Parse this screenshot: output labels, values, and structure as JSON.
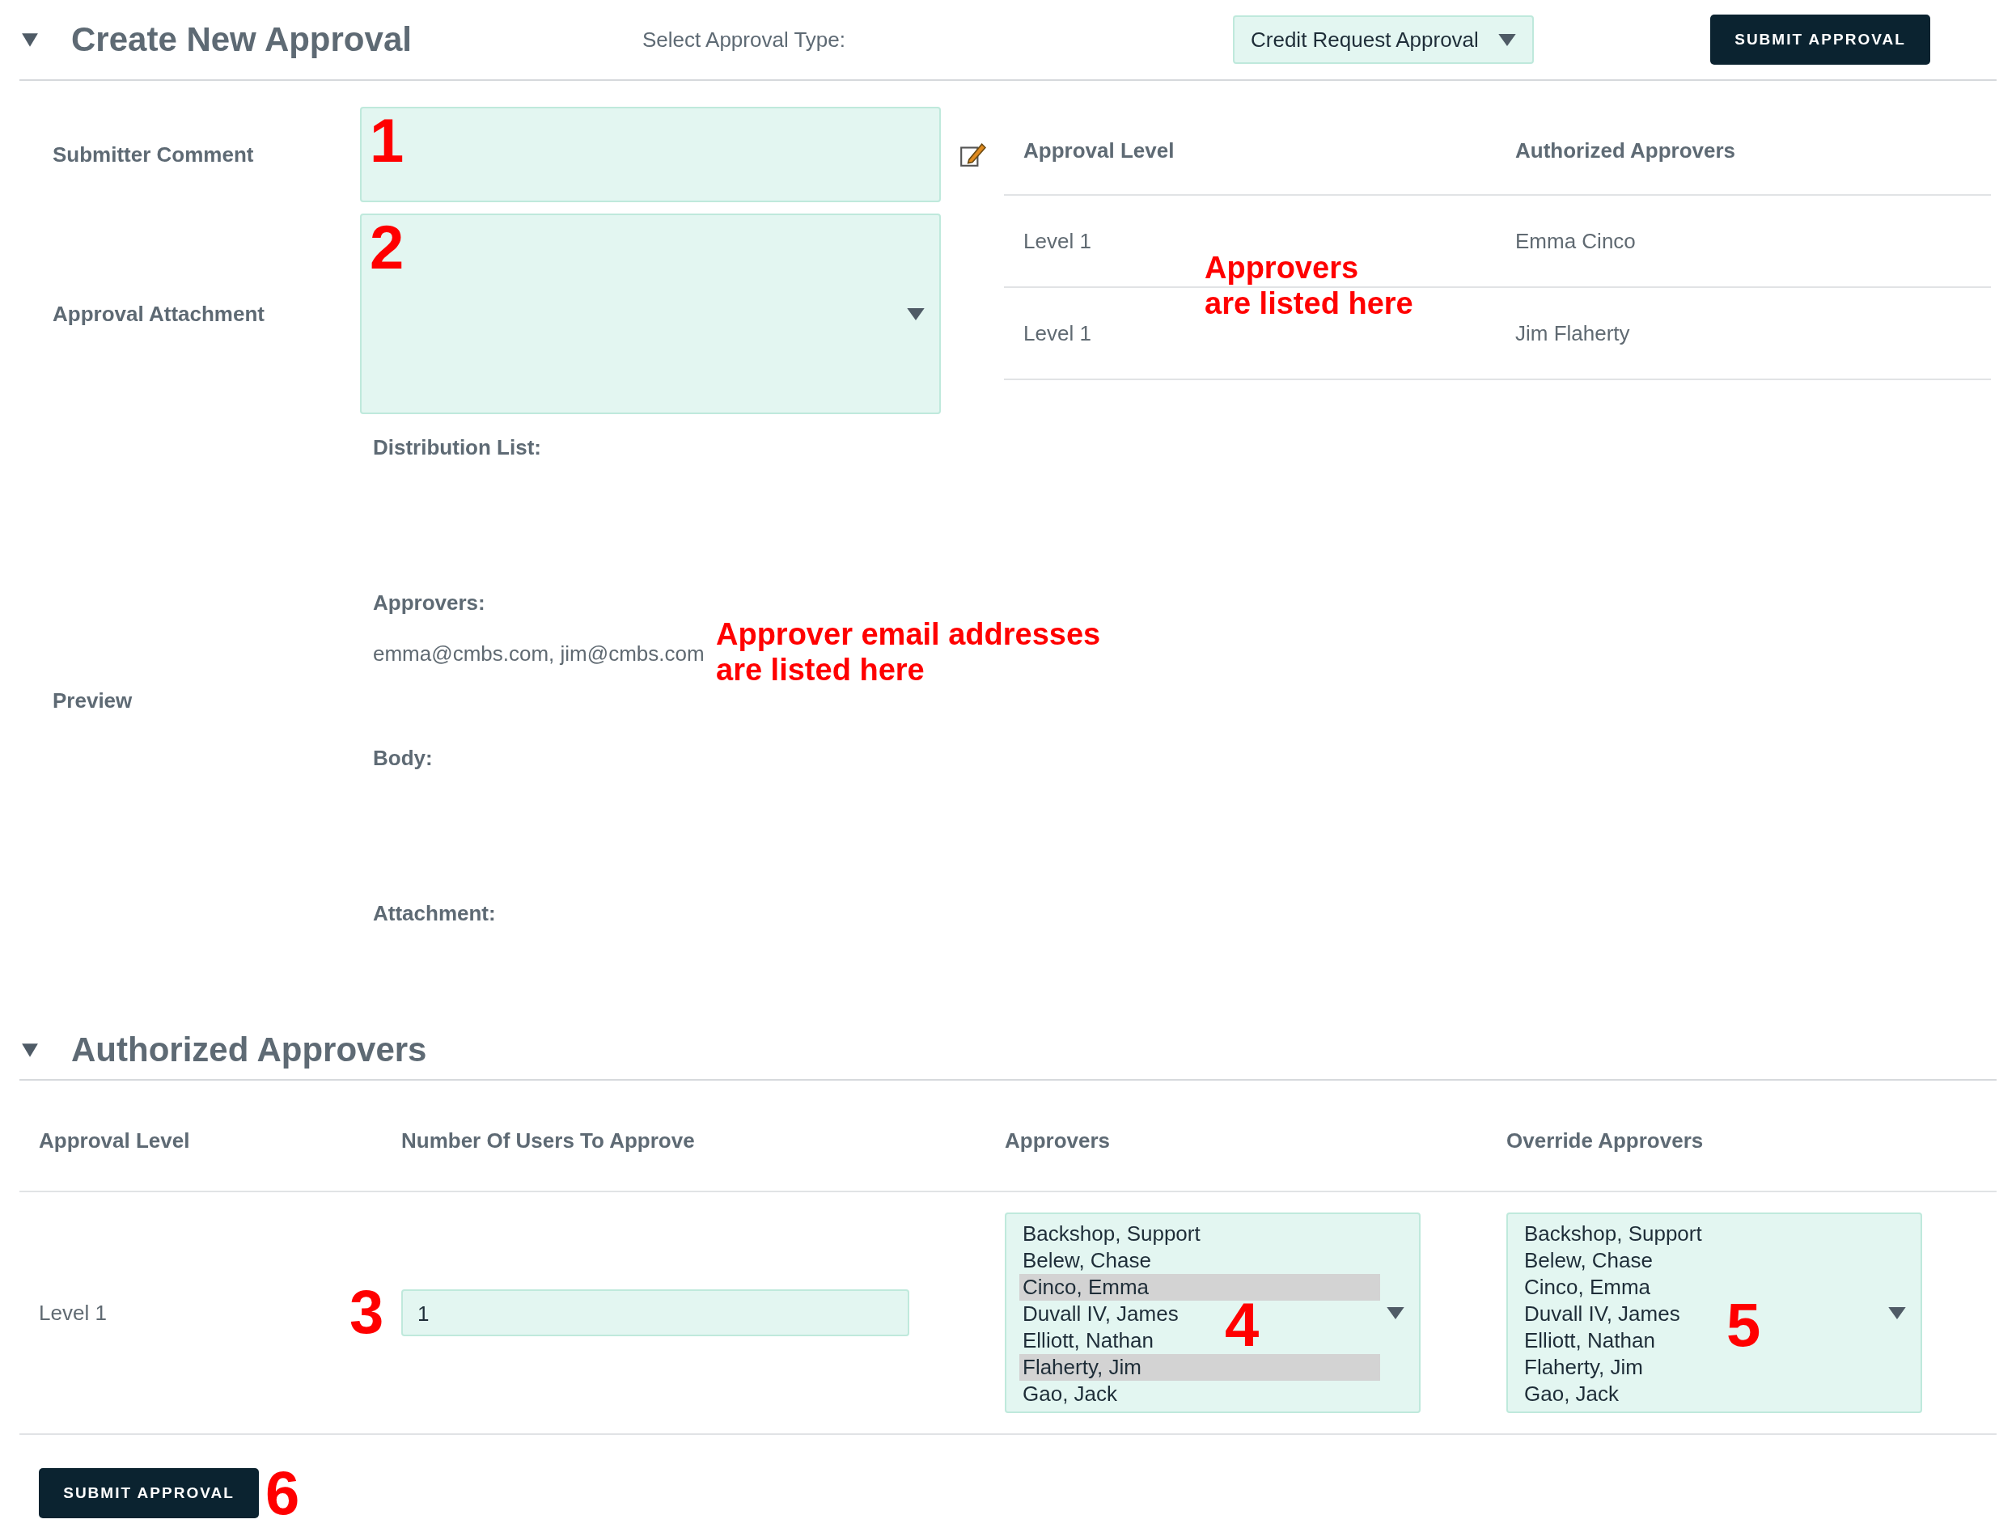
{
  "header": {
    "title": "Create New Approval",
    "expanded": true,
    "type_label": "Select Approval Type:",
    "type_value": "Credit Request Approval",
    "submit": "SUBMIT APPROVAL"
  },
  "form": {
    "comment": {
      "label": "Submitter Comment",
      "marker": "1"
    },
    "attachment": {
      "label": "Approval Attachment",
      "marker": "2"
    }
  },
  "approval_table": {
    "columns": [
      "Approval Level",
      "Authorized Approvers"
    ],
    "rows": [
      {
        "level": "Level 1",
        "approver": "Emma Cinco"
      },
      {
        "level": "Level 1",
        "approver": "Jim Flaherty"
      }
    ],
    "annotation": [
      "Approvers",
      "are listed here"
    ]
  },
  "preview": {
    "label": "Preview",
    "items": [
      {
        "label": "Distribution List:"
      },
      {
        "label": "Approvers:",
        "value": "emma@cmbs.com, jim@cmbs.com",
        "annotation": [
          "Approver email addresses",
          "are listed here"
        ]
      },
      {
        "label": "Body:"
      },
      {
        "label": "Attachment:"
      }
    ]
  },
  "authorized": {
    "title": "Authorized Approvers",
    "expanded": true,
    "columns": [
      "Approval Level",
      "Number Of Users To Approve",
      "Approvers",
      "Override Approvers"
    ],
    "rows": [
      {
        "level": "Level 1",
        "count": "1",
        "count_marker": "3",
        "approvers": {
          "marker": "4",
          "options": [
            {
              "label": "Backshop, Support",
              "selected": false
            },
            {
              "label": "Belew, Chase",
              "selected": false
            },
            {
              "label": "Cinco, Emma",
              "selected": true
            },
            {
              "label": "Duvall IV, James",
              "selected": false
            },
            {
              "label": "Elliott, Nathan",
              "selected": false
            },
            {
              "label": "Flaherty, Jim",
              "selected": true
            },
            {
              "label": "Gao, Jack",
              "selected": false
            }
          ]
        },
        "override": {
          "marker": "5",
          "options": [
            {
              "label": "Backshop, Support",
              "selected": false
            },
            {
              "label": "Belew, Chase",
              "selected": false
            },
            {
              "label": "Cinco, Emma",
              "selected": false
            },
            {
              "label": "Duvall IV, James",
              "selected": false
            },
            {
              "label": "Elliott, Nathan",
              "selected": false
            },
            {
              "label": "Flaherty, Jim",
              "selected": false
            },
            {
              "label": "Gao, Jack",
              "selected": false
            }
          ]
        }
      }
    ]
  },
  "footer": {
    "submit": "SUBMIT APPROVAL",
    "marker": "6"
  }
}
